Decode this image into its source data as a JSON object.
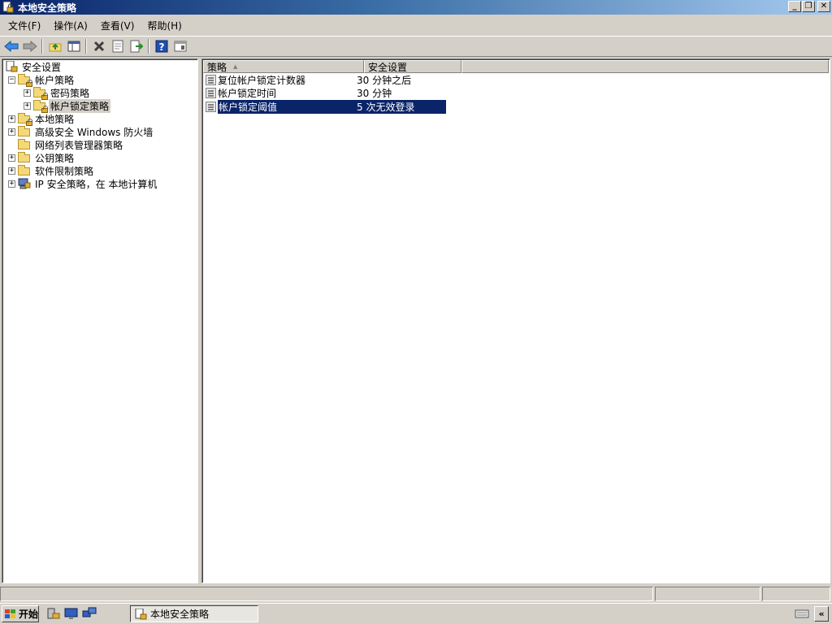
{
  "window": {
    "title": "本地安全策略",
    "minimize_label": "_",
    "restore_label": "❐",
    "close_label": "✕"
  },
  "menu": [
    "文件(F)",
    "操作(A)",
    "查看(V)",
    "帮助(H)"
  ],
  "toolbar": {
    "buttons": [
      "back-icon",
      "forward-icon",
      "up-folder-icon",
      "show-hide-tree-icon",
      "delete-icon",
      "properties-icon",
      "export-list-icon",
      "help-icon",
      "console-icon"
    ]
  },
  "tree": {
    "root": "安全设置",
    "items": [
      {
        "label": "帐户策略",
        "expander": "−",
        "level": 1
      },
      {
        "label": "密码策略",
        "expander": "+",
        "level": 2
      },
      {
        "label": "帐户锁定策略",
        "expander": "+",
        "level": 2,
        "selected": true
      },
      {
        "label": "本地策略",
        "expander": "+",
        "level": 1
      },
      {
        "label": "高级安全 Windows 防火墙",
        "expander": "+",
        "level": 1
      },
      {
        "label": "网络列表管理器策略",
        "expander": "",
        "level": 1
      },
      {
        "label": "公钥策略",
        "expander": "+",
        "level": 1
      },
      {
        "label": "软件限制策略",
        "expander": "+",
        "level": 1
      },
      {
        "label": "IP 安全策略，在 本地计算机",
        "expander": "+",
        "level": 1
      }
    ]
  },
  "list": {
    "columns": [
      "策略",
      "安全设置"
    ],
    "sort_indicator": "▲",
    "rows": [
      {
        "policy": "复位帐户锁定计数器",
        "setting": "30 分钟之后"
      },
      {
        "policy": "帐户锁定时间",
        "setting": "30 分钟"
      },
      {
        "policy": "帐户锁定阈值",
        "setting": "5 次无效登录",
        "selected": true
      }
    ]
  },
  "taskbar": {
    "start_label": "开始",
    "task_label": "本地安全策略",
    "tray_toggle": "«"
  },
  "colors": {
    "selection": "#0a246a",
    "title_gradient_start": "#0a246a",
    "title_gradient_end": "#a6caf0",
    "chrome": "#d4d0c8"
  }
}
